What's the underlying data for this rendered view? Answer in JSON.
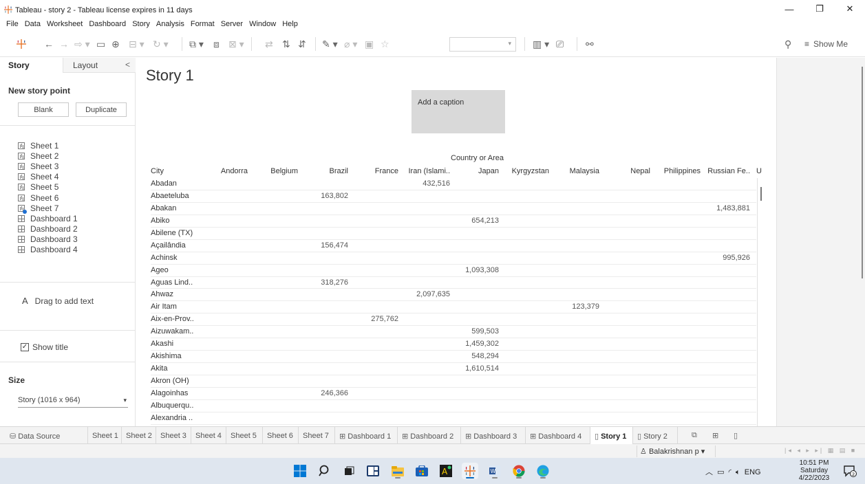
{
  "window": {
    "title": "Tableau - story 2 - Tableau license expires in 11 days",
    "controls": [
      "minimize",
      "restore",
      "close"
    ]
  },
  "menu": [
    "File",
    "Data",
    "Worksheet",
    "Dashboard",
    "Story",
    "Analysis",
    "Format",
    "Server",
    "Window",
    "Help"
  ],
  "toolbar": {
    "show_me": "Show Me"
  },
  "left_pane": {
    "tabs": {
      "story": "Story",
      "layout": "Layout",
      "collapse": "<"
    },
    "new_story_point": "New story point",
    "blank_label": "Blank",
    "duplicate_label": "Duplicate",
    "sheets": [
      {
        "name": "Sheet 1",
        "kind": "worksheet"
      },
      {
        "name": "Sheet 2",
        "kind": "worksheet"
      },
      {
        "name": "Sheet 3",
        "kind": "worksheet"
      },
      {
        "name": "Sheet 4",
        "kind": "worksheet"
      },
      {
        "name": "Sheet 5",
        "kind": "worksheet"
      },
      {
        "name": "Sheet 6",
        "kind": "worksheet"
      },
      {
        "name": "Sheet 7",
        "kind": "worksheet-used"
      },
      {
        "name": "Dashboard 1",
        "kind": "dashboard"
      },
      {
        "name": "Dashboard 2",
        "kind": "dashboard"
      },
      {
        "name": "Dashboard 3",
        "kind": "dashboard"
      },
      {
        "name": "Dashboard 4",
        "kind": "dashboard"
      }
    ],
    "drag_text": "Drag to add text",
    "drag_icon": "A",
    "show_title": "Show title",
    "show_title_checked": true,
    "size_heading": "Size",
    "size_value": "Story (1016 x 964)"
  },
  "story": {
    "title": "Story 1",
    "caption": "Add a caption"
  },
  "table": {
    "group_header": "Country or Area",
    "row_header": "City",
    "columns": [
      "Andorra",
      "Belgium",
      "Brazil",
      "France",
      "Iran (Islami..",
      "Japan",
      "Kyrgyzstan",
      "Malaysia",
      "Nepal",
      "Philippines",
      "Russian Fe..",
      "U"
    ],
    "rows": [
      {
        "city": "Abadan",
        "col": "Iran (Islami..",
        "value": "432,516"
      },
      {
        "city": "Abaeteluba",
        "col": "Brazil",
        "value": "163,802"
      },
      {
        "city": "Abakan",
        "col": "Russian Fe..",
        "value": "1,483,881"
      },
      {
        "city": "Abiko",
        "col": "Japan",
        "value": "654,213"
      },
      {
        "city": "Abilene (TX)",
        "col": "",
        "value": ""
      },
      {
        "city": "Açailândia",
        "col": "Brazil",
        "value": "156,474"
      },
      {
        "city": "Achinsk",
        "col": "Russian Fe..",
        "value": "995,926"
      },
      {
        "city": "Ageo",
        "col": "Japan",
        "value": "1,093,308"
      },
      {
        "city": "Aguas Lind..",
        "col": "Brazil",
        "value": "318,276"
      },
      {
        "city": "Ahwaz",
        "col": "Iran (Islami..",
        "value": "2,097,635"
      },
      {
        "city": "Air Itam",
        "col": "Malaysia",
        "value": "123,379"
      },
      {
        "city": "Aix-en-Prov..",
        "col": "France",
        "value": "275,762"
      },
      {
        "city": "Aizuwakam..",
        "col": "Japan",
        "value": "599,503"
      },
      {
        "city": "Akashi",
        "col": "Japan",
        "value": "1,459,302"
      },
      {
        "city": "Akishima",
        "col": "Japan",
        "value": "548,294"
      },
      {
        "city": "Akita",
        "col": "Japan",
        "value": "1,610,514"
      },
      {
        "city": "Akron (OH)",
        "col": "",
        "value": ""
      },
      {
        "city": "Alagoinhas",
        "col": "Brazil",
        "value": "246,366"
      },
      {
        "city": "Albuquerqu..",
        "col": "",
        "value": ""
      },
      {
        "city": "Alexandria ..",
        "col": "",
        "value": ""
      }
    ]
  },
  "bottom_tabs": [
    {
      "label": "Data Source",
      "icon": "⛁",
      "active": false
    },
    {
      "label": "Sheet 1",
      "icon": "",
      "active": false
    },
    {
      "label": "Sheet 2",
      "icon": "",
      "active": false
    },
    {
      "label": "Sheet 3",
      "icon": "",
      "active": false
    },
    {
      "label": "Sheet 4",
      "icon": "",
      "active": false
    },
    {
      "label": "Sheet 5",
      "icon": "",
      "active": false
    },
    {
      "label": "Sheet 6",
      "icon": "",
      "active": false
    },
    {
      "label": "Sheet 7",
      "icon": "",
      "active": false
    },
    {
      "label": "Dashboard 1",
      "icon": "⊞",
      "active": false
    },
    {
      "label": "Dashboard 2",
      "icon": "⊞",
      "active": false
    },
    {
      "label": "Dashboard 3",
      "icon": "⊞",
      "active": false
    },
    {
      "label": "Dashboard 4",
      "icon": "⊞",
      "active": false
    },
    {
      "label": "Story 1",
      "icon": "▯",
      "active": true
    },
    {
      "label": "Story 2",
      "icon": "▯",
      "active": false
    }
  ],
  "status": {
    "user": "Balakrishnan p"
  },
  "tray": {
    "language": "ENG",
    "time": "10:51 PM",
    "day": "Saturday",
    "date": "4/22/2023"
  },
  "colors": {
    "caption_bg": "#d9d9d9",
    "accent": "#0067c0",
    "taskbar": "#dfe6ef"
  }
}
